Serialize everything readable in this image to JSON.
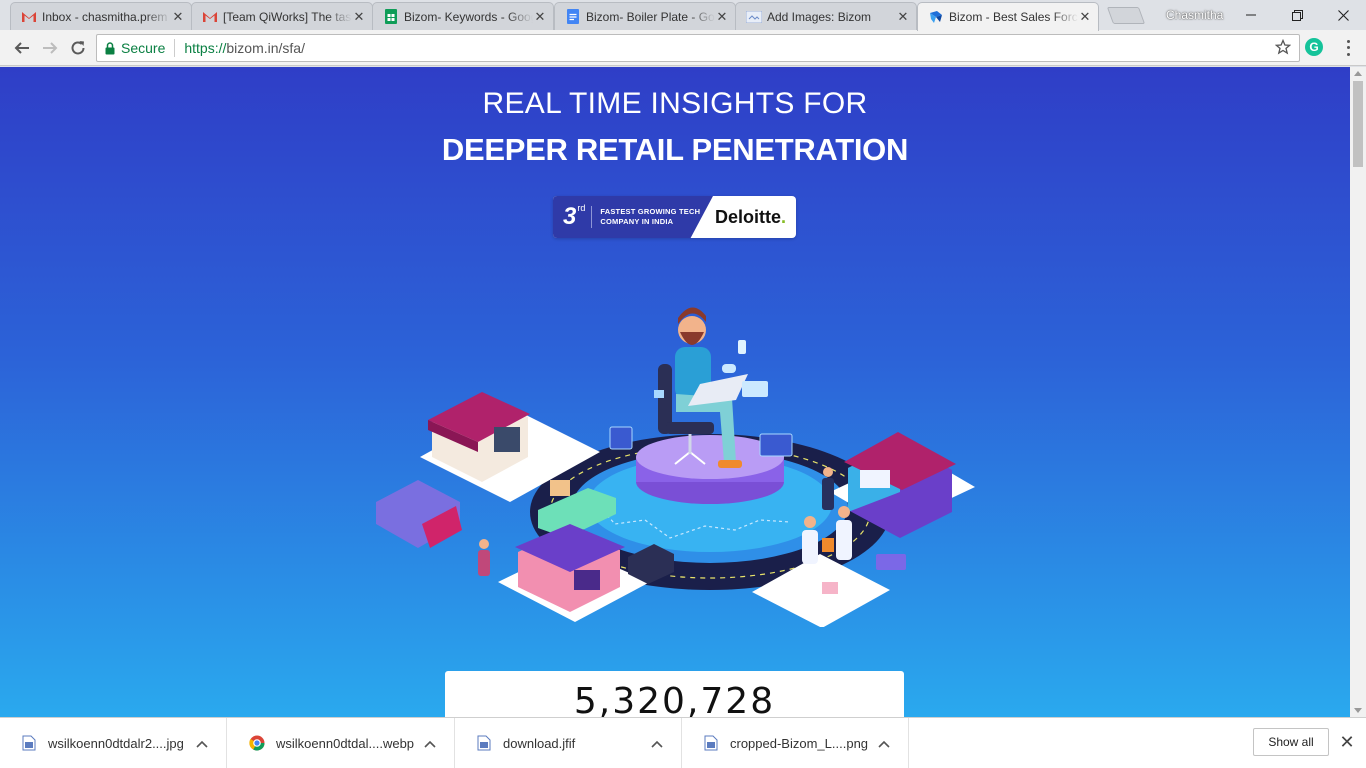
{
  "browser": {
    "tabs": [
      {
        "title": "Inbox - chasmitha.prem",
        "favicon": "gmail-icon",
        "active": false
      },
      {
        "title": "[Team QiWorks] The task",
        "favicon": "gmail-icon",
        "active": false
      },
      {
        "title": "Bizom- Keywords - Google Sheets",
        "favicon": "sheets-icon",
        "active": false
      },
      {
        "title": "Bizom- Boiler Plate - Google Docs",
        "favicon": "docs-icon",
        "active": false
      },
      {
        "title": "Add Images: Bizom",
        "favicon": "page-icon",
        "active": false
      },
      {
        "title": "Bizom - Best Sales Force Automation",
        "favicon": "bizom-icon",
        "active": true
      }
    ],
    "profile_name": "Chasmitha",
    "security_label": "Secure",
    "url_scheme": "https://",
    "url_rest": "bizom.in/sfa/",
    "extension_label": "G"
  },
  "page": {
    "headline_line1": "REAL TIME INSIGHTS FOR",
    "headline_line2": "DEEPER RETAIL PENETRATION",
    "badge": {
      "rank": "3",
      "rank_suffix": "rd",
      "line1": "FASTEST GROWING TECH",
      "line2": "COMPANY IN INDIA",
      "brand": "Deloitte",
      "brand_dot": "."
    },
    "counter_value": "5,320,728",
    "colors": {
      "hero_top": "#2f3ec7",
      "hero_bottom": "#2aa9ee",
      "badge_blue": "#2f3aa8",
      "deloitte_green": "#86bc25"
    }
  },
  "downloads": {
    "items": [
      {
        "name": "wsilkoenn0dtdalr2....jpg",
        "icon": "file-icon"
      },
      {
        "name": "wsilkoenn0dtdal....webp",
        "icon": "chrome-icon"
      },
      {
        "name": "download.jfif",
        "icon": "file-icon"
      },
      {
        "name": "cropped-Bizom_L....png",
        "icon": "file-icon"
      }
    ],
    "show_all_label": "Show all"
  }
}
